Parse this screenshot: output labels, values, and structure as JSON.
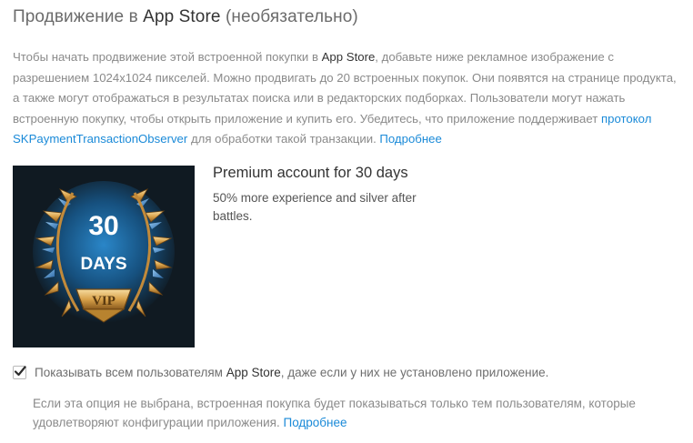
{
  "section": {
    "title_prefix": "Продвижение в ",
    "title_app_store": "App Store",
    "title_suffix": " (необязательно)"
  },
  "description": {
    "part1": "Чтобы начать продвижение этой встроенной покупки в ",
    "app_store": "App Store",
    "part2": ", добавьте ниже рекламное изображение с разрешением 1024x1024 пикселей. Можно продвигать до 20 встроенных покупок. Они появятся на странице продукта, а также могут отображаться в результатах поиска или в редакторских подборках. Пользователи могут нажать встроенную покупку, чтобы открыть приложение и купить его. Убедитесь, что приложение поддерживает ",
    "protocol_link": "протокол SKPaymentTransactionObserver",
    "part3": " для обработки такой транзакции. ",
    "more_link": "Подробнее"
  },
  "promo_image": {
    "number": "30",
    "days": "DAYS",
    "badge": "VIP",
    "icon": "premium-badge-icon"
  },
  "product": {
    "title": "Premium account for 30 days",
    "description": "50% more experience and silver after battles."
  },
  "checkbox": {
    "checked": true,
    "label_prefix": "Показывать всем пользователям ",
    "label_app_store": "App Store",
    "label_suffix": ", даже если у них не установлено приложение."
  },
  "helper": {
    "text": "Если эта опция не выбрана, встроенная покупка будет показываться только тем пользователям, которые удовлетворяют конфигурации приложения. ",
    "more_link": "Подробнее"
  },
  "colors": {
    "link": "#1a8ad8",
    "checkmark": "#2b2b2b",
    "image_bg": "#101a22",
    "image_glow": "#1e6fa8",
    "gold": "#d9a24a"
  }
}
